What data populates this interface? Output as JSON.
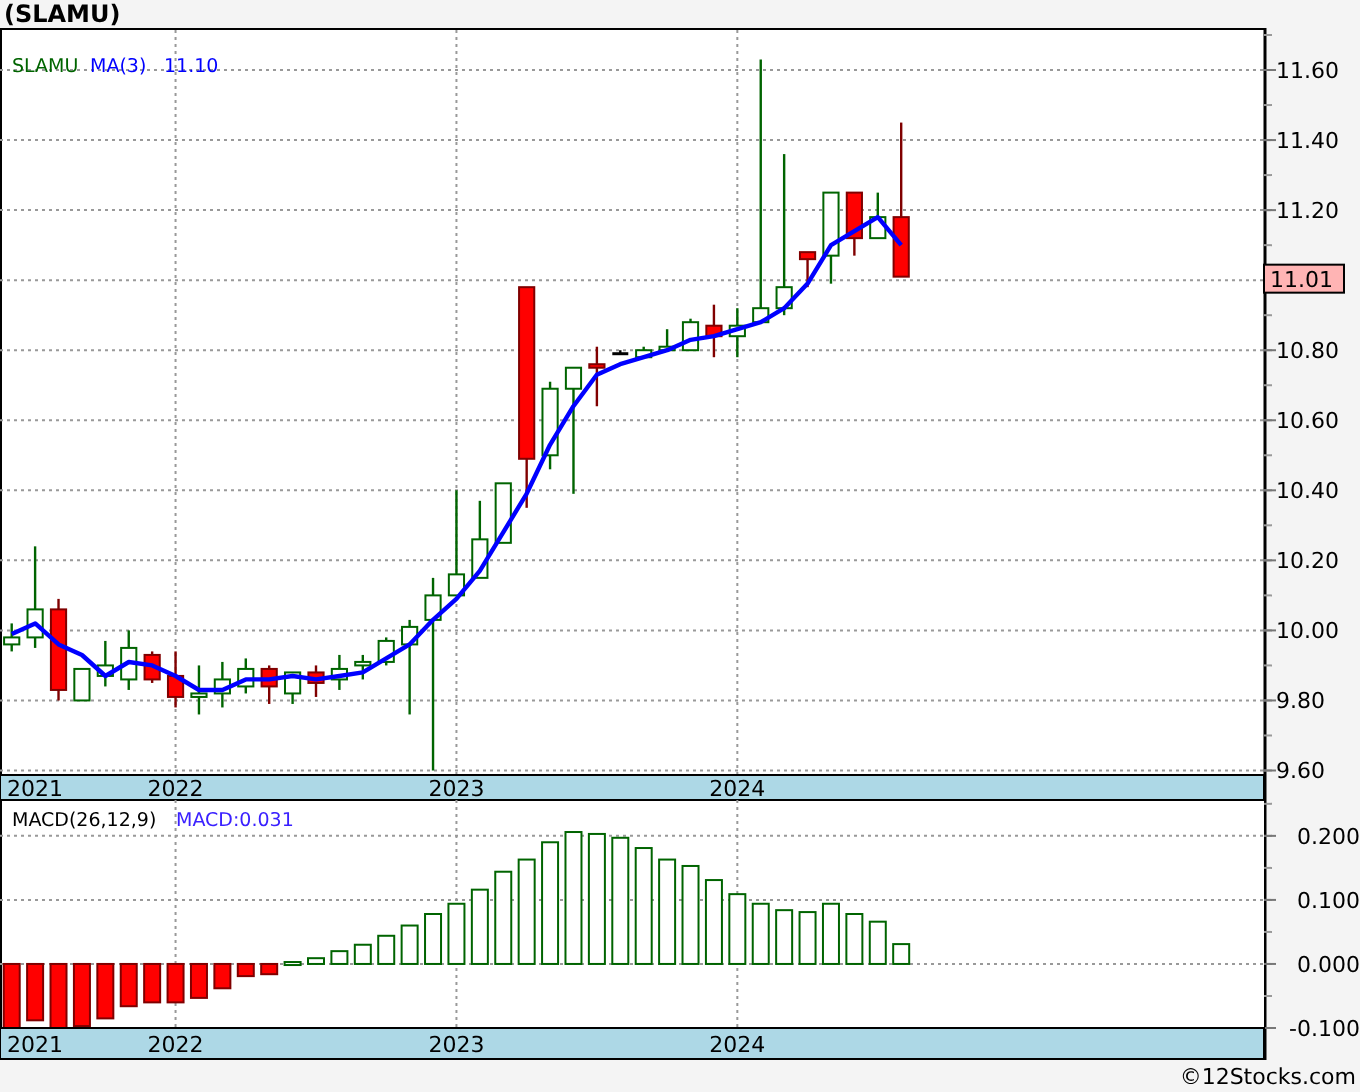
{
  "title": "(SLAMU)",
  "price_panel": {
    "legend": {
      "symbol": "SLAMU",
      "reading": "11.10"
    },
    "last_price": "11.01",
    "chart_data": {
      "type": "candlestick",
      "orientation": "vertical",
      "grid": true,
      "categories": [
        null,
        "2021",
        null,
        null,
        null,
        null,
        null,
        "2022",
        null,
        null,
        null,
        null,
        null,
        null,
        null,
        null,
        null,
        null,
        null,
        "2023",
        null,
        null,
        null,
        null,
        null,
        null,
        null,
        null,
        null,
        null,
        null,
        "2024",
        null,
        null,
        null,
        null,
        null,
        null,
        null,
        null,
        null,
        null,
        null,
        null,
        null,
        null,
        null,
        null,
        null,
        null,
        null,
        null,
        null,
        null
      ],
      "ylim": [
        9.59,
        11.72
      ],
      "yticks": [
        {
          "value": 9.6,
          "label": "9.60"
        },
        {
          "value": 9.8,
          "label": "9.80"
        },
        {
          "value": 10,
          "label": "10.00"
        },
        {
          "value": 10.2,
          "label": "10.20"
        },
        {
          "value": 10.4,
          "label": "10.40"
        },
        {
          "value": 10.6,
          "label": "10.60"
        },
        {
          "value": 10.8,
          "label": "10.80"
        },
        {
          "value": 11.2,
          "label": "11.20"
        },
        {
          "value": 11.4,
          "label": "11.40"
        },
        {
          "value": 11.6,
          "label": "11.60"
        }
      ],
      "ohlc": [
        [
          9.96,
          10.02,
          9.94,
          9.98
        ],
        [
          9.98,
          10.24,
          9.95,
          10.06
        ],
        [
          10.06,
          10.09,
          9.8,
          9.83
        ],
        [
          9.8,
          9.89,
          9.8,
          9.89
        ],
        [
          9.87,
          9.97,
          9.84,
          9.9
        ],
        [
          9.86,
          10.0,
          9.83,
          9.95
        ],
        [
          9.93,
          9.94,
          9.85,
          9.86
        ],
        [
          9.87,
          9.94,
          9.78,
          9.81
        ],
        [
          9.81,
          9.9,
          9.76,
          9.82
        ],
        [
          9.82,
          9.91,
          9.78,
          9.86
        ],
        [
          9.84,
          9.92,
          9.82,
          9.89
        ],
        [
          9.89,
          9.9,
          9.79,
          9.84
        ],
        [
          9.82,
          9.88,
          9.79,
          9.88
        ],
        [
          9.88,
          9.9,
          9.81,
          9.85
        ],
        [
          9.86,
          9.93,
          9.83,
          9.89
        ],
        [
          9.9,
          9.93,
          9.86,
          9.91
        ],
        [
          9.91,
          9.98,
          9.9,
          9.97
        ],
        [
          9.96,
          10.03,
          9.76,
          10.01
        ],
        [
          10.03,
          10.15,
          9.6,
          10.1
        ],
        [
          10.1,
          10.4,
          10.1,
          10.16
        ],
        [
          10.15,
          10.37,
          10.15,
          10.26
        ],
        [
          10.25,
          10.42,
          10.25,
          10.42
        ],
        [
          10.98,
          10.98,
          10.35,
          10.49
        ],
        [
          10.5,
          10.71,
          10.46,
          10.69
        ],
        [
          10.69,
          10.75,
          10.39,
          10.75
        ],
        [
          10.76,
          10.81,
          10.64,
          10.75
        ],
        [
          10.79,
          10.8,
          10.79,
          10.79
        ],
        [
          10.78,
          10.81,
          10.78,
          10.8
        ],
        [
          10.8,
          10.86,
          10.8,
          10.81
        ],
        [
          10.8,
          10.89,
          10.8,
          10.88
        ],
        [
          10.87,
          10.93,
          10.78,
          10.84
        ],
        [
          10.84,
          10.92,
          10.78,
          10.87
        ],
        [
          10.88,
          11.63,
          10.88,
          10.92
        ],
        [
          10.92,
          11.36,
          10.9,
          10.98
        ],
        [
          11.08,
          11.08,
          10.98,
          11.06
        ],
        [
          11.07,
          11.25,
          10.99,
          11.25
        ],
        [
          11.25,
          11.25,
          11.07,
          11.12
        ],
        [
          11.12,
          11.25,
          11.12,
          11.18
        ],
        [
          11.18,
          11.45,
          11.01,
          11.01
        ],
        null,
        null,
        null,
        null,
        null,
        null,
        null,
        null,
        null,
        null,
        null,
        null,
        null,
        null,
        null
      ],
      "series": [
        {
          "name": "MA(3)",
          "type": "line",
          "color": "#0000ff",
          "values": [
            9.99,
            10.02,
            9.96,
            9.93,
            9.87,
            9.91,
            9.9,
            9.87,
            9.83,
            9.83,
            9.86,
            9.86,
            9.87,
            9.86,
            9.87,
            9.88,
            9.92,
            9.96,
            10.03,
            10.09,
            10.17,
            10.28,
            10.39,
            10.53,
            10.64,
            10.73,
            10.76,
            10.78,
            10.8,
            10.83,
            10.84,
            10.86,
            10.88,
            10.92,
            10.99,
            11.1,
            11.14,
            11.18,
            11.1,
            null,
            null,
            null,
            null,
            null,
            null,
            null,
            null,
            null,
            null,
            null,
            null,
            null,
            null,
            null
          ]
        }
      ]
    }
  },
  "macd_panel": {
    "legend": {
      "indicator": "MACD(26,12,9)",
      "reading": "MACD:0.031"
    },
    "chart_data": {
      "type": "bar",
      "orientation": "vertical",
      "grid": true,
      "categories": [
        null,
        "2021",
        null,
        null,
        null,
        null,
        null,
        "2022",
        null,
        null,
        null,
        null,
        null,
        null,
        null,
        null,
        null,
        null,
        null,
        "2023",
        null,
        null,
        null,
        null,
        null,
        null,
        null,
        null,
        null,
        null,
        null,
        "2024",
        null,
        null,
        null,
        null,
        null,
        null,
        null,
        null,
        null,
        null,
        null,
        null,
        null,
        null,
        null,
        null,
        null,
        null,
        null,
        null,
        null,
        null
      ],
      "ylim": [
        -0.1,
        0.256
      ],
      "yticks": [
        {
          "value": -0.1,
          "label": "-0.100"
        },
        {
          "value": 0,
          "label": "0.000"
        },
        {
          "value": 0.1,
          "label": "0.100"
        },
        {
          "value": 0.2,
          "label": "0.200"
        }
      ],
      "values": [
        -0.1,
        -0.088,
        -0.1,
        -0.097,
        -0.085,
        -0.066,
        -0.06,
        -0.06,
        -0.053,
        -0.038,
        -0.019,
        -0.016,
        0.003,
        0.009,
        0.02,
        0.03,
        0.044,
        0.06,
        0.078,
        0.094,
        0.116,
        0.144,
        0.163,
        0.19,
        0.206,
        0.203,
        0.197,
        0.181,
        0.163,
        0.153,
        0.131,
        0.109,
        0.094,
        0.084,
        0.081,
        0.094,
        0.078,
        0.066,
        0.031,
        null,
        null,
        null,
        null,
        null,
        null,
        null,
        null,
        null,
        null,
        null,
        null,
        null,
        null,
        null
      ]
    }
  },
  "credit": "©12Stocks.com"
}
